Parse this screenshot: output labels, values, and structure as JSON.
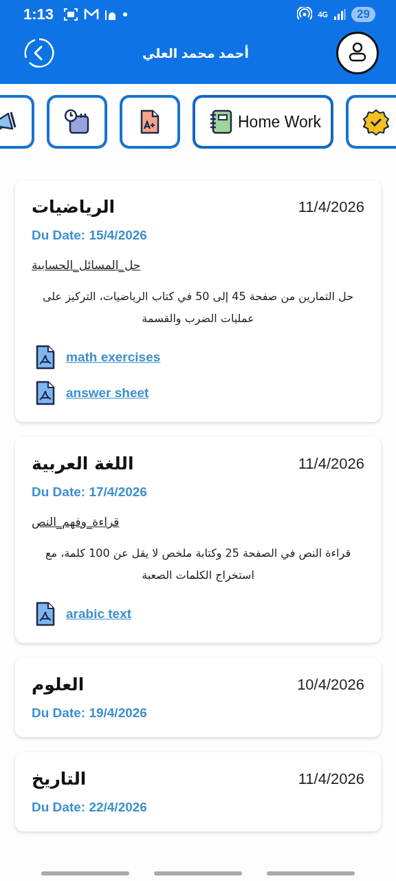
{
  "status_bar": {
    "time": "1:13",
    "battery": "29",
    "network": "4G"
  },
  "header": {
    "title": "أحمد محمد العلي"
  },
  "tabs": [
    {
      "kind": "megaphone",
      "selected": false
    },
    {
      "kind": "schedule",
      "selected": false
    },
    {
      "kind": "grades",
      "selected": false
    },
    {
      "kind": "notebook",
      "label": "Home Work",
      "selected": true
    },
    {
      "kind": "badge",
      "selected": false
    }
  ],
  "homework": [
    {
      "subject": "الرياضيات",
      "date": "11/4/2026",
      "due": "Du Date: 15/4/2026",
      "title": "حل_المسائل_الحسابية",
      "description": "حل التمارين من صفحة 45 إلى 50 في كتاب الرياضيات، التركيز على عمليات الضرب والقسمة",
      "attachments": [
        {
          "name": "math exercises"
        },
        {
          "name": "answer sheet"
        }
      ]
    },
    {
      "subject": "اللغة العربية",
      "date": "11/4/2026",
      "due": "Du Date: 17/4/2026",
      "title": "قراءة_وفهم_النص",
      "description": "قراءة النص في الصفحة 25 وكتابة ملخص لا يقل عن 100 كلمة، مع استخراج الكلمات الصعبة",
      "attachments": [
        {
          "name": "arabic text"
        }
      ]
    },
    {
      "subject": "العلوم",
      "date": "10/4/2026",
      "due": "Du Date: 19/4/2026"
    },
    {
      "subject": "التاريخ",
      "date": "11/4/2026",
      "due": "Du Date: 22/4/2026"
    }
  ]
}
